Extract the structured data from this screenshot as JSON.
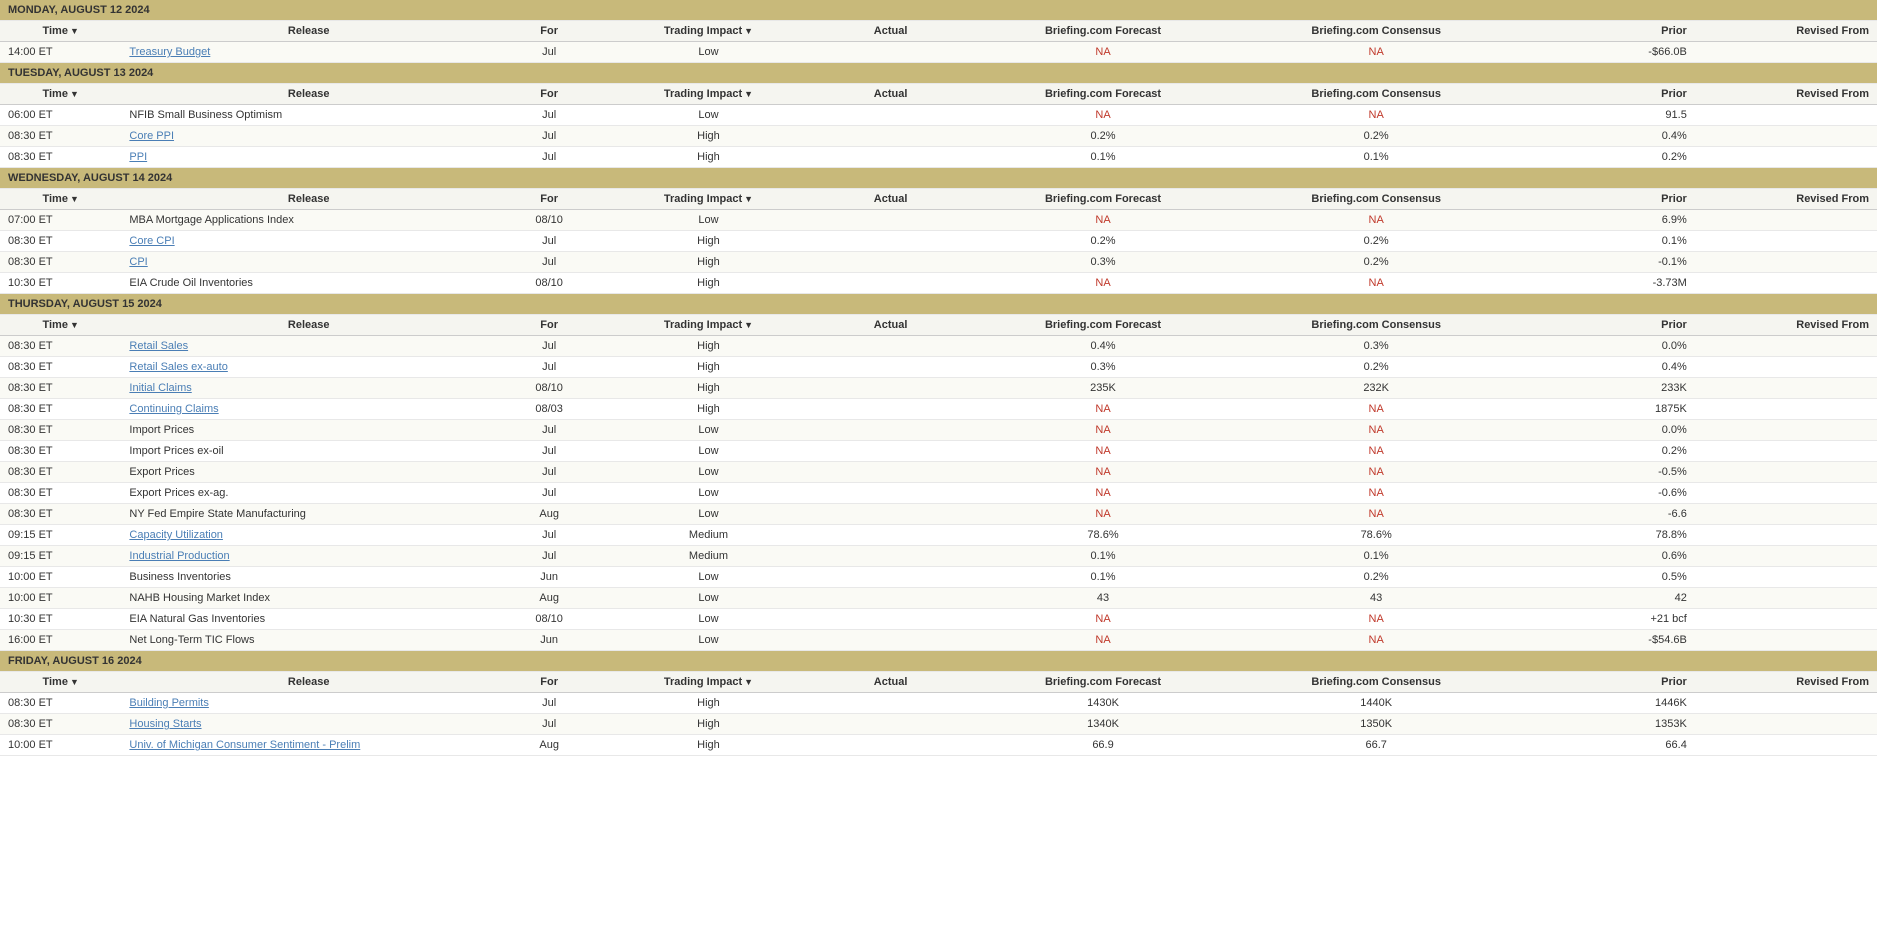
{
  "days": [
    {
      "label": "MONDAY, AUGUST 12 2024",
      "headers": [
        "Time",
        "Release",
        "For",
        "Trading Impact",
        "Actual",
        "Briefing.com Forecast",
        "Briefing.com Consensus",
        "Prior",
        "Revised From"
      ],
      "rows": [
        {
          "time": "14:00 ET",
          "release": "Treasury Budget",
          "release_link": true,
          "for": "Jul",
          "impact": "Low",
          "actual": "",
          "bc_forecast": "NA",
          "bc_consensus": "NA",
          "prior": "-$66.0B",
          "revised": ""
        }
      ]
    },
    {
      "label": "TUESDAY, AUGUST 13 2024",
      "headers": [
        "Time",
        "Release",
        "For",
        "Trading Impact",
        "Actual",
        "Briefing.com Forecast",
        "Briefing.com Consensus",
        "Prior",
        "Revised From"
      ],
      "rows": [
        {
          "time": "06:00 ET",
          "release": "NFIB Small Business Optimism",
          "release_link": false,
          "for": "Jul",
          "impact": "Low",
          "actual": "",
          "bc_forecast": "NA",
          "bc_consensus": "NA",
          "prior": "91.5",
          "revised": ""
        },
        {
          "time": "08:30 ET",
          "release": "Core PPI",
          "release_link": true,
          "for": "Jul",
          "impact": "High",
          "actual": "",
          "bc_forecast": "0.2%",
          "bc_consensus": "0.2%",
          "prior": "0.4%",
          "revised": ""
        },
        {
          "time": "08:30 ET",
          "release": "PPI",
          "release_link": true,
          "for": "Jul",
          "impact": "High",
          "actual": "",
          "bc_forecast": "0.1%",
          "bc_consensus": "0.1%",
          "prior": "0.2%",
          "revised": ""
        }
      ]
    },
    {
      "label": "WEDNESDAY, AUGUST 14 2024",
      "headers": [
        "Time",
        "Release",
        "For",
        "Trading Impact",
        "Actual",
        "Briefing.com Forecast",
        "Briefing.com Consensus",
        "Prior",
        "Revised From"
      ],
      "rows": [
        {
          "time": "07:00 ET",
          "release": "MBA Mortgage Applications Index",
          "release_link": false,
          "for": "08/10",
          "impact": "Low",
          "actual": "",
          "bc_forecast": "NA",
          "bc_consensus": "NA",
          "prior": "6.9%",
          "revised": ""
        },
        {
          "time": "08:30 ET",
          "release": "Core CPI",
          "release_link": true,
          "for": "Jul",
          "impact": "High",
          "actual": "",
          "bc_forecast": "0.2%",
          "bc_consensus": "0.2%",
          "prior": "0.1%",
          "revised": ""
        },
        {
          "time": "08:30 ET",
          "release": "CPI",
          "release_link": true,
          "for": "Jul",
          "impact": "High",
          "actual": "",
          "bc_forecast": "0.3%",
          "bc_consensus": "0.2%",
          "prior": "-0.1%",
          "revised": ""
        },
        {
          "time": "10:30 ET",
          "release": "EIA Crude Oil Inventories",
          "release_link": false,
          "for": "08/10",
          "impact": "High",
          "actual": "",
          "bc_forecast": "NA",
          "bc_consensus": "NA",
          "prior": "-3.73M",
          "revised": ""
        }
      ]
    },
    {
      "label": "THURSDAY, AUGUST 15 2024",
      "headers": [
        "Time",
        "Release",
        "For",
        "Trading Impact",
        "Actual",
        "Briefing.com Forecast",
        "Briefing.com Consensus",
        "Prior",
        "Revised From"
      ],
      "rows": [
        {
          "time": "08:30 ET",
          "release": "Retail Sales",
          "release_link": true,
          "for": "Jul",
          "impact": "High",
          "actual": "",
          "bc_forecast": "0.4%",
          "bc_consensus": "0.3%",
          "prior": "0.0%",
          "revised": ""
        },
        {
          "time": "08:30 ET",
          "release": "Retail Sales ex-auto",
          "release_link": true,
          "for": "Jul",
          "impact": "High",
          "actual": "",
          "bc_forecast": "0.3%",
          "bc_consensus": "0.2%",
          "prior": "0.4%",
          "revised": ""
        },
        {
          "time": "08:30 ET",
          "release": "Initial Claims",
          "release_link": true,
          "for": "08/10",
          "impact": "High",
          "actual": "",
          "bc_forecast": "235K",
          "bc_consensus": "232K",
          "prior": "233K",
          "revised": ""
        },
        {
          "time": "08:30 ET",
          "release": "Continuing Claims",
          "release_link": true,
          "for": "08/03",
          "impact": "High",
          "actual": "",
          "bc_forecast": "NA",
          "bc_consensus": "NA",
          "prior": "1875K",
          "revised": ""
        },
        {
          "time": "08:30 ET",
          "release": "Import Prices",
          "release_link": false,
          "for": "Jul",
          "impact": "Low",
          "actual": "",
          "bc_forecast": "NA",
          "bc_consensus": "NA",
          "prior": "0.0%",
          "revised": ""
        },
        {
          "time": "08:30 ET",
          "release": "Import Prices ex-oil",
          "release_link": false,
          "for": "Jul",
          "impact": "Low",
          "actual": "",
          "bc_forecast": "NA",
          "bc_consensus": "NA",
          "prior": "0.2%",
          "revised": ""
        },
        {
          "time": "08:30 ET",
          "release": "Export Prices",
          "release_link": false,
          "for": "Jul",
          "impact": "Low",
          "actual": "",
          "bc_forecast": "NA",
          "bc_consensus": "NA",
          "prior": "-0.5%",
          "revised": ""
        },
        {
          "time": "08:30 ET",
          "release": "Export Prices ex-ag.",
          "release_link": false,
          "for": "Jul",
          "impact": "Low",
          "actual": "",
          "bc_forecast": "NA",
          "bc_consensus": "NA",
          "prior": "-0.6%",
          "revised": ""
        },
        {
          "time": "08:30 ET",
          "release": "NY Fed Empire State Manufacturing",
          "release_link": false,
          "for": "Aug",
          "impact": "Low",
          "actual": "",
          "bc_forecast": "NA",
          "bc_consensus": "NA",
          "prior": "-6.6",
          "revised": ""
        },
        {
          "time": "09:15 ET",
          "release": "Capacity Utilization",
          "release_link": true,
          "for": "Jul",
          "impact": "Medium",
          "actual": "",
          "bc_forecast": "78.6%",
          "bc_consensus": "78.6%",
          "prior": "78.8%",
          "revised": ""
        },
        {
          "time": "09:15 ET",
          "release": "Industrial Production",
          "release_link": true,
          "for": "Jul",
          "impact": "Medium",
          "actual": "",
          "bc_forecast": "0.1%",
          "bc_consensus": "0.1%",
          "prior": "0.6%",
          "revised": ""
        },
        {
          "time": "10:00 ET",
          "release": "Business Inventories",
          "release_link": false,
          "for": "Jun",
          "impact": "Low",
          "actual": "",
          "bc_forecast": "0.1%",
          "bc_consensus": "0.2%",
          "prior": "0.5%",
          "revised": ""
        },
        {
          "time": "10:00 ET",
          "release": "NAHB Housing Market Index",
          "release_link": false,
          "for": "Aug",
          "impact": "Low",
          "actual": "",
          "bc_forecast": "43",
          "bc_consensus": "43",
          "prior": "42",
          "revised": ""
        },
        {
          "time": "10:30 ET",
          "release": "EIA Natural Gas Inventories",
          "release_link": false,
          "for": "08/10",
          "impact": "Low",
          "actual": "",
          "bc_forecast": "NA",
          "bc_consensus": "NA",
          "prior": "+21 bcf",
          "revised": ""
        },
        {
          "time": "16:00 ET",
          "release": "Net Long-Term TIC Flows",
          "release_link": false,
          "for": "Jun",
          "impact": "Low",
          "actual": "",
          "bc_forecast": "NA",
          "bc_consensus": "NA",
          "prior": "-$54.6B",
          "revised": ""
        }
      ]
    },
    {
      "label": "FRIDAY, AUGUST 16 2024",
      "headers": [
        "Time",
        "Release",
        "For",
        "Trading Impact",
        "Actual",
        "Briefing.com Forecast",
        "Briefing.com Consensus",
        "Prior",
        "Revised From"
      ],
      "rows": [
        {
          "time": "08:30 ET",
          "release": "Building Permits",
          "release_link": true,
          "for": "Jul",
          "impact": "High",
          "actual": "",
          "bc_forecast": "1430K",
          "bc_consensus": "1440K",
          "prior": "1446K",
          "revised": ""
        },
        {
          "time": "08:30 ET",
          "release": "Housing Starts",
          "release_link": true,
          "for": "Jul",
          "impact": "High",
          "actual": "",
          "bc_forecast": "1340K",
          "bc_consensus": "1350K",
          "prior": "1353K",
          "revised": ""
        },
        {
          "time": "10:00 ET",
          "release": "Univ. of Michigan Consumer Sentiment - Prelim",
          "release_link": true,
          "for": "Aug",
          "impact": "High",
          "actual": "",
          "bc_forecast": "66.9",
          "bc_consensus": "66.7",
          "prior": "66.4",
          "revised": ""
        }
      ]
    }
  ]
}
